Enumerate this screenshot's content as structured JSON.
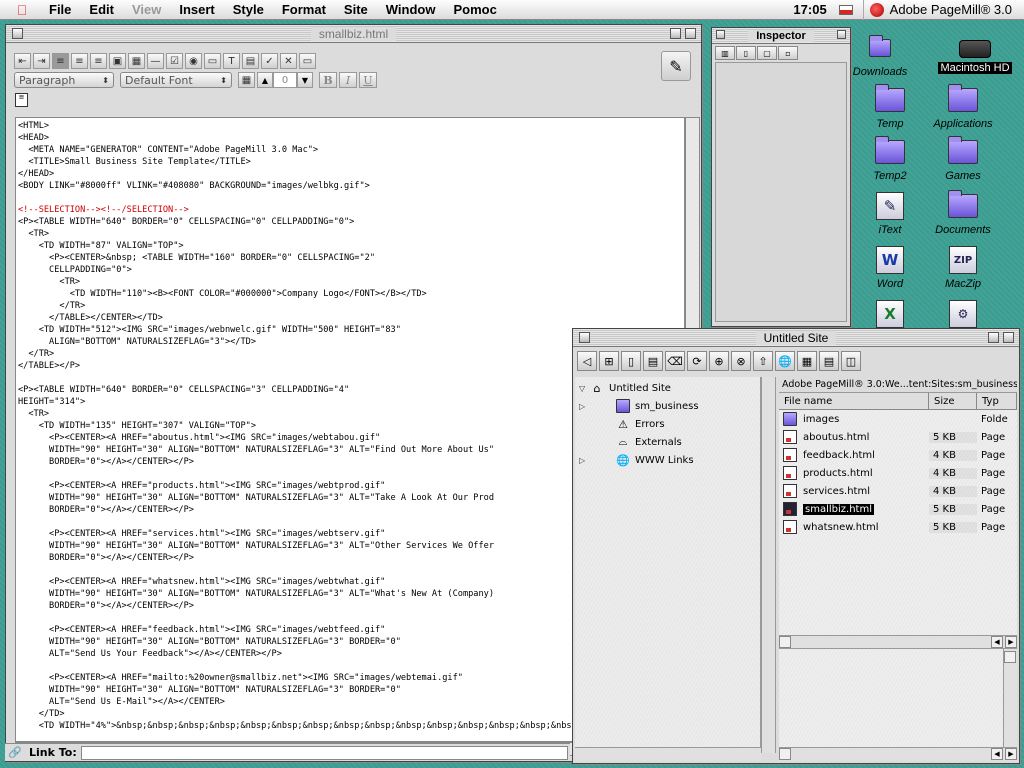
{
  "menubar": {
    "items": [
      "File",
      "Edit",
      "View",
      "Insert",
      "Style",
      "Format",
      "Site",
      "Window",
      "Pomoc"
    ],
    "dimmed_item": "View",
    "clock": "17:05",
    "app_name": "Adobe PageMill® 3.0"
  },
  "editor": {
    "title": "smallbiz.html",
    "paragraph_style": "Paragraph",
    "font": "Default Font",
    "font_size": "0",
    "bold_label": "B",
    "italic_label": "I",
    "underline_label": "U",
    "link_label": "Link To:",
    "link_value": "",
    "code_lines": [
      "<HTML>",
      "<HEAD>",
      "  <META NAME=\"GENERATOR\" CONTENT=\"Adobe PageMill 3.0 Mac\">",
      "  <TITLE>Small Business Site Template</TITLE>",
      "</HEAD>",
      "<BODY LINK=\"#8000ff\" VLINK=\"#408080\" BACKGROUND=\"images/welbkg.gif\">",
      "",
      "<!--SELECTION--><!--/SELECTION-->",
      "<P><TABLE WIDTH=\"640\" BORDER=\"0\" CELLSPACING=\"0\" CELLPADDING=\"0\">",
      "  <TR>",
      "    <TD WIDTH=\"87\" VALIGN=\"TOP\">",
      "      <P><CENTER>&nbsp; <TABLE WIDTH=\"160\" BORDER=\"0\" CELLSPACING=\"2\"",
      "      CELLPADDING=\"0\">",
      "        <TR>",
      "          <TD WIDTH=\"110\"><B><FONT COLOR=\"#000000\">Company Logo</FONT></B></TD>",
      "        </TR>",
      "      </TABLE></CENTER></TD>",
      "    <TD WIDTH=\"512\"><IMG SRC=\"images/webnwelc.gif\" WIDTH=\"500\" HEIGHT=\"83\"",
      "      ALIGN=\"BOTTOM\" NATURALSIZEFLAG=\"3\"></TD>",
      "  </TR>",
      "</TABLE></P>",
      "",
      "<P><TABLE WIDTH=\"640\" BORDER=\"0\" CELLSPACING=\"3\" CELLPADDING=\"4\"",
      "HEIGHT=\"314\">",
      "  <TR>",
      "    <TD WIDTH=\"135\" HEIGHT=\"307\" VALIGN=\"TOP\">",
      "      <P><CENTER><A HREF=\"aboutus.html\"><IMG SRC=\"images/webtabou.gif\"",
      "      WIDTH=\"90\" HEIGHT=\"30\" ALIGN=\"BOTTOM\" NATURALSIZEFLAG=\"3\" ALT=\"Find Out More About Us\"",
      "      BORDER=\"0\"></A></CENTER></P>",
      "",
      "      <P><CENTER><A HREF=\"products.html\"><IMG SRC=\"images/webtprod.gif\"",
      "      WIDTH=\"90\" HEIGHT=\"30\" ALIGN=\"BOTTOM\" NATURALSIZEFLAG=\"3\" ALT=\"Take A Look At Our Prod",
      "      BORDER=\"0\"></A></CENTER></P>",
      "",
      "      <P><CENTER><A HREF=\"services.html\"><IMG SRC=\"images/webtserv.gif\"",
      "      WIDTH=\"90\" HEIGHT=\"30\" ALIGN=\"BOTTOM\" NATURALSIZEFLAG=\"3\" ALT=\"Other Services We Offer",
      "      BORDER=\"0\"></A></CENTER></P>",
      "",
      "      <P><CENTER><A HREF=\"whatsnew.html\"><IMG SRC=\"images/webtwhat.gif\"",
      "      WIDTH=\"90\" HEIGHT=\"30\" ALIGN=\"BOTTOM\" NATURALSIZEFLAG=\"3\" ALT=\"What's New At (Company)",
      "      BORDER=\"0\"></A></CENTER></P>",
      "",
      "      <P><CENTER><A HREF=\"feedback.html\"><IMG SRC=\"images/webtfeed.gif\"",
      "      WIDTH=\"90\" HEIGHT=\"30\" ALIGN=\"BOTTOM\" NATURALSIZEFLAG=\"3\" BORDER=\"0\"",
      "      ALT=\"Send Us Your Feedback\"></A></CENTER></P>",
      "",
      "      <P><CENTER><A HREF=\"mailto:%20owner@smallbiz.net\"><IMG SRC=\"images/webtemai.gif\"",
      "      WIDTH=\"90\" HEIGHT=\"30\" ALIGN=\"BOTTOM\" NATURALSIZEFLAG=\"3\" BORDER=\"0\"",
      "      ALT=\"Send Us E-Mail\"></A></CENTER>",
      "    </TD>",
      "    <TD WIDTH=\"4%\">&nbsp;&nbsp;&nbsp;&nbsp;&nbsp;&nbsp;&nbsp;&nbsp;&nbsp;&nbsp;&nbsp;&nbsp;&nbsp;&nbsp;&nbsp;"
    ],
    "red_line_indices": [
      7
    ]
  },
  "inspector": {
    "title": "Inspector"
  },
  "desktop_icons": [
    {
      "name": "downloads",
      "label": "Downloads",
      "kind": "downloads"
    },
    {
      "name": "macintosh-hd",
      "label": "Macintosh HD",
      "kind": "hd"
    },
    {
      "name": "temp",
      "label": "Temp",
      "kind": "folder"
    },
    {
      "name": "applications",
      "label": "Applications",
      "kind": "folder"
    },
    {
      "name": "temp2",
      "label": "Temp2",
      "kind": "folder"
    },
    {
      "name": "games",
      "label": "Games",
      "kind": "folder"
    },
    {
      "name": "itext",
      "label": "iText",
      "kind": "app"
    },
    {
      "name": "documents",
      "label": "Documents",
      "kind": "folder"
    },
    {
      "name": "word",
      "label": "Word",
      "kind": "app"
    },
    {
      "name": "maczip",
      "label": "MacZip",
      "kind": "app"
    }
  ],
  "site_window": {
    "title": "Untitled Site",
    "tree": [
      {
        "label": "Untitled Site",
        "level": 0,
        "expanded": true,
        "icon": "home"
      },
      {
        "label": "sm_business",
        "level": 1,
        "expandable": true,
        "icon": "folder"
      },
      {
        "label": "Errors",
        "level": 1,
        "icon": "warning"
      },
      {
        "label": "Externals",
        "level": 1,
        "icon": "externals"
      },
      {
        "label": "WWW Links",
        "level": 1,
        "expandable": true,
        "icon": "globe"
      }
    ],
    "path": "Adobe PageMill® 3.0:We...tent:Sites:sm_business:",
    "columns": [
      "File name",
      "Size",
      "Typ"
    ],
    "files": [
      {
        "name": "images",
        "size": "",
        "type": "Folde",
        "kind": "folder"
      },
      {
        "name": "aboutus.html",
        "size": "5 KB",
        "type": "Page",
        "kind": "html"
      },
      {
        "name": "feedback.html",
        "size": "4 KB",
        "type": "Page",
        "kind": "html"
      },
      {
        "name": "products.html",
        "size": "4 KB",
        "type": "Page",
        "kind": "html"
      },
      {
        "name": "services.html",
        "size": "4 KB",
        "type": "Page",
        "kind": "html"
      },
      {
        "name": "smallbiz.html",
        "size": "5 KB",
        "type": "Page",
        "kind": "html",
        "selected": true
      },
      {
        "name": "whatsnew.html",
        "size": "5 KB",
        "type": "Page",
        "kind": "html"
      }
    ]
  }
}
